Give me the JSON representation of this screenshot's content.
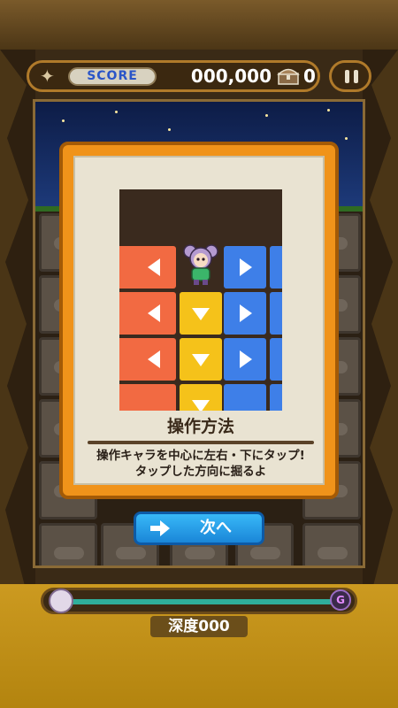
{
  "header": {
    "score_label": "SCORE",
    "score_value": "000,000",
    "chest_count": "0",
    "star_icon": "sparkle-icon",
    "chest_icon": "treasure-chest-icon",
    "pause_icon": "pause-icon"
  },
  "tutorial": {
    "title": "操作方法",
    "description_line1": "操作キャラを中心に左右・下にタップ!",
    "description_line2": "タップした方向に掘るよ",
    "next_label": "次へ",
    "next_icon": "arrow-right-icon",
    "tile_colors": {
      "left": "#f26a42",
      "right": "#3e7fe8",
      "down": "#f5c21a"
    }
  },
  "footer": {
    "depth_label": "深度000",
    "start_marker_icon": "character-face-icon",
    "goal_marker_text": "G",
    "depth_progress": 0
  },
  "colors": {
    "accent_orange": "#f0931a",
    "button_blue": "#1a86d8",
    "background_brown": "#3a2a16",
    "footer_gold": "#cc9a20"
  }
}
